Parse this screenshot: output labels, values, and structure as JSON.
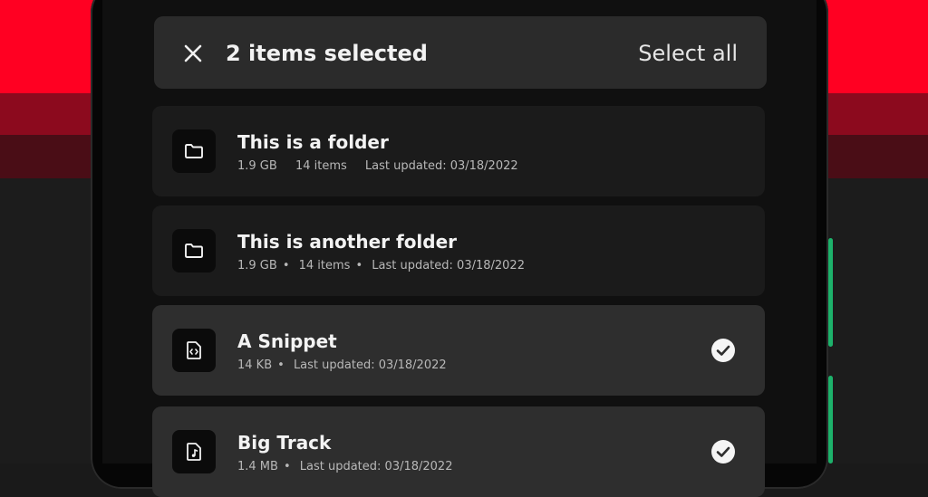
{
  "colors": {
    "accent_red": "#ff0022",
    "accent_green": "#1db26b"
  },
  "selection_bar": {
    "close_icon": "close-icon",
    "count_text": "2 items selected",
    "select_all_label": "Select all"
  },
  "items": [
    {
      "icon": "folder-icon",
      "title": "This is a folder",
      "size": "1.9 GB",
      "count": "14 items",
      "updated": "Last updated: 03/18/2022",
      "selected": false
    },
    {
      "icon": "folder-icon",
      "title": "This is another folder",
      "size": "1.9 GB",
      "count": "14 items",
      "updated": "Last updated: 03/18/2022",
      "selected": false
    },
    {
      "icon": "code-file-icon",
      "title": "A Snippet",
      "size": "14 KB",
      "updated": "Last updated: 03/18/2022",
      "selected": true
    },
    {
      "icon": "music-file-icon",
      "title": "Big Track",
      "size": "1.4 MB",
      "updated": "Last updated: 03/18/2022",
      "selected": true
    }
  ]
}
